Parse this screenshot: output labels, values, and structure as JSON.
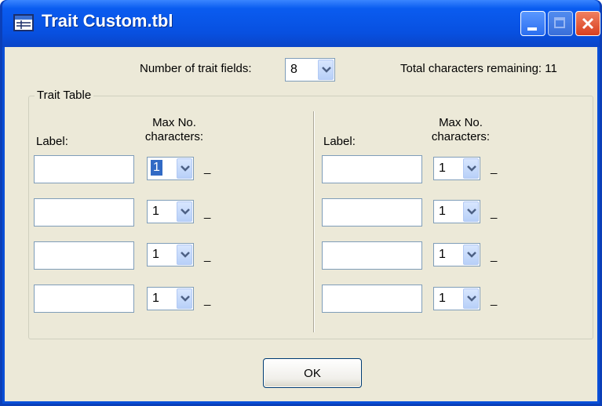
{
  "window": {
    "title": "Trait Custom.tbl",
    "icon": "table-window-icon",
    "controls": [
      "minimize-icon",
      "maximize-icon",
      "close-icon"
    ]
  },
  "header": {
    "num_fields_label": "Number of trait fields:",
    "num_fields_value": "8",
    "remaining_label": "Total characters remaining: 11"
  },
  "trait_table": {
    "legend": "Trait Table",
    "label_header": "Label:",
    "max_header_line1": "Max No.",
    "max_header_line2": "characters:",
    "rows": [
      {
        "label": "",
        "max": "1",
        "placeholder": "_"
      },
      {
        "label": "",
        "max": "1",
        "placeholder": "_"
      },
      {
        "label": "",
        "max": "1",
        "placeholder": "_"
      },
      {
        "label": "",
        "max": "1",
        "placeholder": "_"
      },
      {
        "label": "",
        "max": "1",
        "placeholder": "_"
      },
      {
        "label": "",
        "max": "1",
        "placeholder": "_"
      },
      {
        "label": "",
        "max": "1",
        "placeholder": "_"
      },
      {
        "label": "",
        "max": "1",
        "placeholder": "_"
      }
    ]
  },
  "buttons": {
    "ok": "OK"
  },
  "colors": {
    "title_bar": "#0a5cf0",
    "client_bg": "#ece9d8",
    "selection": "#316ac5"
  }
}
